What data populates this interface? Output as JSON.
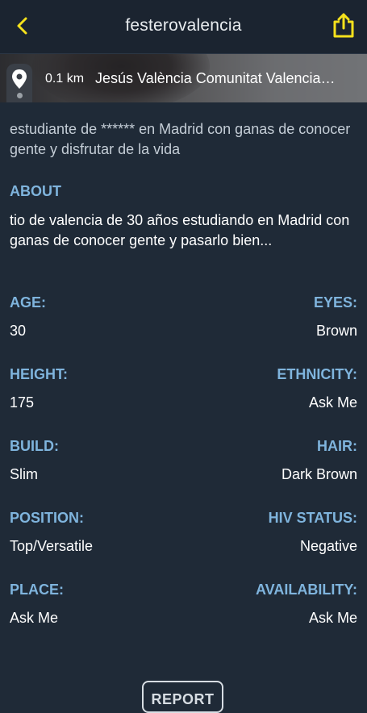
{
  "header": {
    "title": "festerovalencia",
    "back_icon": "chevron-left-icon",
    "share_icon": "share-icon",
    "accent_color": "#f5e11c"
  },
  "location": {
    "distance": "0.1 km",
    "name": "Jesús València Comunitat Valencia…"
  },
  "headline": "estudiante de ****** en Madrid con ganas de conocer gente y disfrutar de la vida",
  "about": {
    "label": "ABOUT",
    "text": "tio de valencia de 30 años estudiando en Madrid con ganas de conocer gente y pasarlo bien..."
  },
  "fields": [
    {
      "left_label": "AGE:",
      "left_value": "30",
      "right_label": "EYES:",
      "right_value": "Brown"
    },
    {
      "left_label": "HEIGHT:",
      "left_value": "175",
      "right_label": "ETHNICITY:",
      "right_value": "Ask Me"
    },
    {
      "left_label": "BUILD:",
      "left_value": "Slim",
      "right_label": "HAIR:",
      "right_value": "Dark Brown"
    },
    {
      "left_label": "POSITION:",
      "left_value": "Top/Versatile",
      "right_label": "HIV STATUS:",
      "right_value": "Negative"
    },
    {
      "left_label": "PLACE:",
      "left_value": "Ask Me",
      "right_label": "AVAILABILITY:",
      "right_value": "Ask Me"
    }
  ],
  "report_label": "REPORT"
}
